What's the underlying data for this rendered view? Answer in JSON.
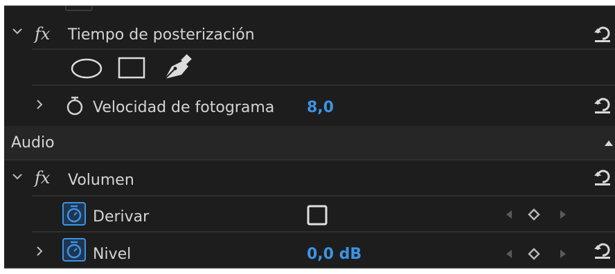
{
  "colors": {
    "panel_bg": "#1d1d1d",
    "section_bg": "#252525",
    "text": "#d4d4d4",
    "accent_blue": "#3d93e3",
    "separator": "#2e2e2e"
  },
  "effects": [
    {
      "fx_label": "fx",
      "name": "Tiempo de posterización",
      "mask_tools": [
        "ellipse-mask-icon",
        "rectangle-mask-icon",
        "pen-mask-icon"
      ],
      "properties": [
        {
          "label": "Velocidad de fotograma",
          "value": "8,0"
        }
      ]
    }
  ],
  "sections": {
    "audio_label": "Audio"
  },
  "volume": {
    "fx_label": "fx",
    "name": "Volumen",
    "properties": [
      {
        "label": "Derivar",
        "control": "checkbox",
        "checked": false
      },
      {
        "label": "Nivel",
        "value": "0,0 dB"
      }
    ]
  },
  "icons": {
    "expand_open": "chevron-down-icon",
    "expand_closed": "chevron-right-icon",
    "stopwatch": "stopwatch-icon",
    "reset": "reset-icon",
    "keyframe_prev": "keyframe-prev-icon",
    "keyframe_add": "keyframe-add-icon",
    "keyframe_next": "keyframe-next-icon",
    "scroll_up": "scroll-up-icon"
  }
}
